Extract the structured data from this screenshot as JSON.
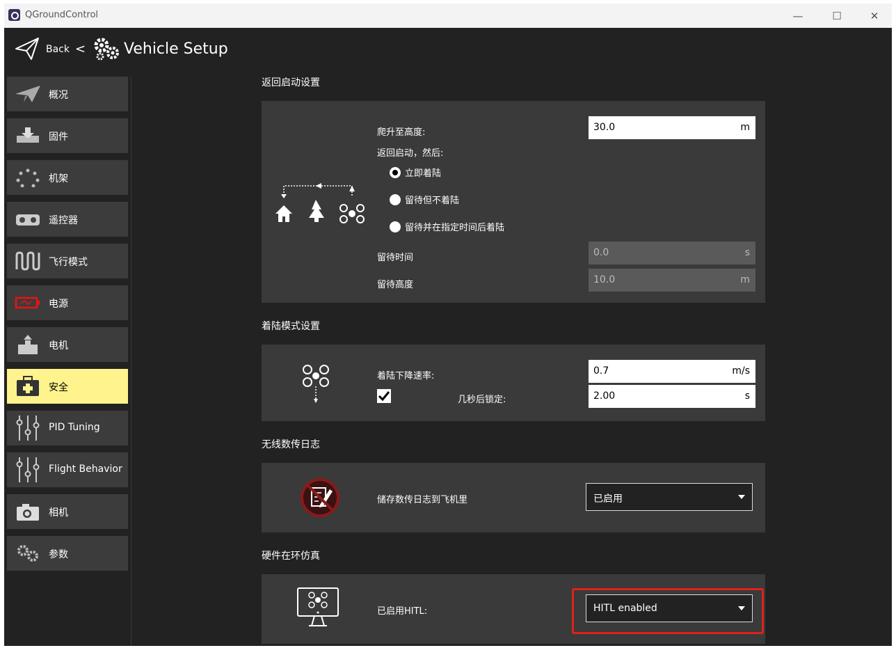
{
  "window": {
    "title": "QGroundControl",
    "minimize": "—",
    "maximize": "☐",
    "close": "✕"
  },
  "toolbar": {
    "back_label": "Back",
    "separator": "<",
    "page_title": "Vehicle Setup"
  },
  "sidebar": {
    "items": [
      {
        "label": "概况",
        "icon": "plane-icon"
      },
      {
        "label": "固件",
        "icon": "firmware-icon"
      },
      {
        "label": "机架",
        "icon": "airframe-icon"
      },
      {
        "label": "遥控器",
        "icon": "radio-icon"
      },
      {
        "label": "飞行模式",
        "icon": "flight-modes-icon"
      },
      {
        "label": "电源",
        "icon": "battery-icon"
      },
      {
        "label": "电机",
        "icon": "motor-icon"
      },
      {
        "label": "安全",
        "icon": "safety-icon",
        "active": true
      },
      {
        "label": "PID Tuning",
        "icon": "sliders-icon"
      },
      {
        "label": "Flight Behavior",
        "icon": "sliders-icon"
      },
      {
        "label": "相机",
        "icon": "camera-icon"
      },
      {
        "label": "参数",
        "icon": "gears-icon"
      }
    ]
  },
  "rtl": {
    "section_title": "返回启动设置",
    "climb_label": "爬升至高度:",
    "climb_value": "30.0",
    "climb_unit": "m",
    "then_label": "返回启动，然后:",
    "options": [
      "立即着陆",
      "留待但不着陆",
      "留待并在指定时间后着陆"
    ],
    "selected_option": 0,
    "loiter_time_label": "留待时间",
    "loiter_time_value": "0.0",
    "loiter_time_unit": "s",
    "loiter_alt_label": "留待高度",
    "loiter_alt_value": "10.0",
    "loiter_alt_unit": "m"
  },
  "landing": {
    "section_title": "着陆模式设置",
    "descent_label": "着陆下降速率:",
    "descent_value": "0.7",
    "descent_unit": "m/s",
    "disarm_label": "几秒后锁定:",
    "disarm_value": "2.00",
    "disarm_unit": "s",
    "disarm_checked": true
  },
  "telemetry": {
    "section_title": "无线数传日志",
    "save_label": "储存数传日志到飞机里",
    "save_value": "已启用"
  },
  "hitl": {
    "section_title": "硬件在环仿真",
    "enabled_label": "已启用HITL:",
    "enabled_value": "HITL enabled"
  },
  "colors": {
    "active_item": "#fef38d",
    "highlight": "#e0201c",
    "panel": "#3a3a3a",
    "background": "#222222"
  }
}
